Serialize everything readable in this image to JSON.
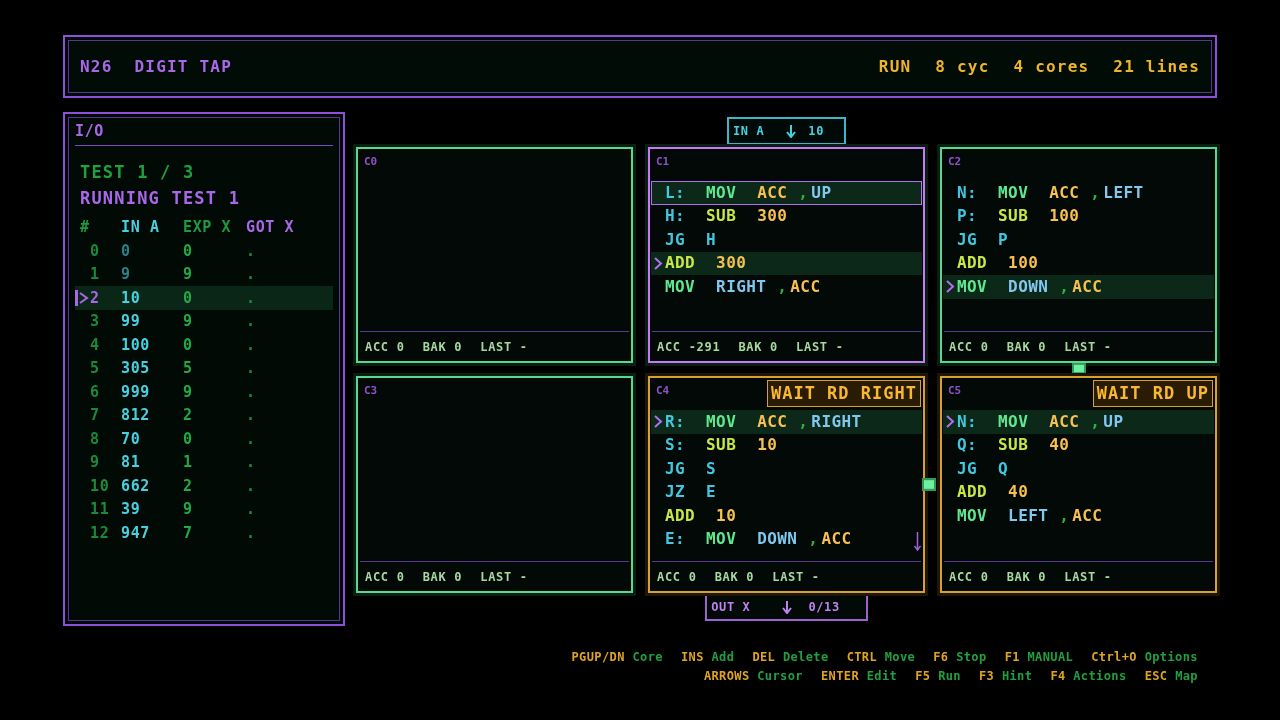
{
  "header": {
    "puzzle_number": "N26",
    "title": "DIGIT TAP",
    "stats": [
      "RUN",
      "8 cyc",
      "4 cores",
      "21 lines"
    ]
  },
  "io": {
    "title": "I/O",
    "test": "TEST 1 / 3",
    "status": "RUNNING TEST 1",
    "columns": [
      {
        "label": "#",
        "kind": "index"
      },
      {
        "label": "IN A",
        "kind": "input"
      },
      {
        "label": "EXP X",
        "kind": "expected"
      },
      {
        "label": "GOT X",
        "kind": "output"
      }
    ],
    "rows": [
      {
        "index": "0",
        "input": "0",
        "expected": "0",
        "got": ".",
        "consumed": true,
        "selected": false
      },
      {
        "index": "1",
        "input": "9",
        "expected": "9",
        "got": ".",
        "consumed": true,
        "selected": false
      },
      {
        "index": "2",
        "input": "10",
        "expected": "0",
        "got": ".",
        "consumed": false,
        "selected": true
      },
      {
        "index": "3",
        "input": "99",
        "expected": "9",
        "got": ".",
        "consumed": false,
        "selected": false
      },
      {
        "index": "4",
        "input": "100",
        "expected": "0",
        "got": ".",
        "consumed": false,
        "selected": false
      },
      {
        "index": "5",
        "input": "305",
        "expected": "5",
        "got": ".",
        "consumed": false,
        "selected": false
      },
      {
        "index": "6",
        "input": "999",
        "expected": "9",
        "got": ".",
        "consumed": false,
        "selected": false
      },
      {
        "index": "7",
        "input": "812",
        "expected": "2",
        "got": ".",
        "consumed": false,
        "selected": false
      },
      {
        "index": "8",
        "input": "70",
        "expected": "0",
        "got": ".",
        "consumed": false,
        "selected": false
      },
      {
        "index": "9",
        "input": "81",
        "expected": "1",
        "got": ".",
        "consumed": false,
        "selected": false
      },
      {
        "index": "10",
        "input": "662",
        "expected": "2",
        "got": ".",
        "consumed": false,
        "selected": false
      },
      {
        "index": "11",
        "input": "39",
        "expected": "9",
        "got": ".",
        "consumed": false,
        "selected": false
      },
      {
        "index": "12",
        "input": "947",
        "expected": "7",
        "got": ".",
        "consumed": false,
        "selected": false
      }
    ]
  },
  "cores": [
    {
      "name": "C0",
      "selected": false,
      "waiting": false,
      "registers": [
        "ACC 0",
        "BAK 0",
        "LAST -"
      ]
    },
    {
      "name": "C1",
      "selected": true,
      "waiting": false,
      "input_port": {
        "label": "IN A",
        "value": "10"
      },
      "lines": [
        {
          "active": false,
          "cursor": true,
          "tokens": [
            {
              "text": "L:",
              "kind": "label"
            },
            {
              "text": "MOV",
              "kind": "move"
            },
            {
              "text": "ACC",
              "kind": "register"
            },
            {
              "text": ",",
              "kind": "comma"
            },
            {
              "text": "UP",
              "kind": "port"
            }
          ]
        },
        {
          "active": false,
          "cursor": false,
          "tokens": [
            {
              "text": "H:",
              "kind": "label"
            },
            {
              "text": "SUB",
              "kind": "math"
            },
            {
              "text": "300",
              "kind": "number"
            }
          ]
        },
        {
          "active": false,
          "cursor": false,
          "tokens": [
            {
              "text": "JG",
              "kind": "jump"
            },
            {
              "text": "H",
              "kind": "target"
            }
          ]
        },
        {
          "active": true,
          "cursor": false,
          "tokens": [
            {
              "text": "ADD",
              "kind": "math"
            },
            {
              "text": "300",
              "kind": "number"
            }
          ]
        },
        {
          "active": false,
          "cursor": false,
          "tokens": [
            {
              "text": "MOV",
              "kind": "move"
            },
            {
              "text": "RIGHT",
              "kind": "port"
            },
            {
              "text": ",",
              "kind": "comma"
            },
            {
              "text": "ACC",
              "kind": "register"
            }
          ]
        }
      ],
      "registers": [
        "ACC -291",
        "BAK 0",
        "LAST -"
      ]
    },
    {
      "name": "C2",
      "selected": false,
      "waiting": false,
      "signal": {
        "kind": "down"
      },
      "lines": [
        {
          "active": false,
          "cursor": false,
          "tokens": [
            {
              "text": "N:",
              "kind": "label"
            },
            {
              "text": "MOV",
              "kind": "move"
            },
            {
              "text": "ACC",
              "kind": "register"
            },
            {
              "text": ",",
              "kind": "comma"
            },
            {
              "text": "LEFT",
              "kind": "port"
            }
          ]
        },
        {
          "active": false,
          "cursor": false,
          "tokens": [
            {
              "text": "P:",
              "kind": "label"
            },
            {
              "text": "SUB",
              "kind": "math"
            },
            {
              "text": "100",
              "kind": "number"
            }
          ]
        },
        {
          "active": false,
          "cursor": false,
          "tokens": [
            {
              "text": "JG",
              "kind": "jump"
            },
            {
              "text": "P",
              "kind": "target"
            }
          ]
        },
        {
          "active": false,
          "cursor": false,
          "tokens": [
            {
              "text": "ADD",
              "kind": "math"
            },
            {
              "text": "100",
              "kind": "number"
            }
          ]
        },
        {
          "active": true,
          "cursor": false,
          "tokens": [
            {
              "text": "MOV",
              "kind": "move"
            },
            {
              "text": "DOWN",
              "kind": "port"
            },
            {
              "text": ",",
              "kind": "comma"
            },
            {
              "text": "ACC",
              "kind": "register"
            }
          ]
        }
      ],
      "registers": [
        "ACC 0",
        "BAK 0",
        "LAST -"
      ]
    },
    {
      "name": "C3",
      "selected": false,
      "waiting": false,
      "registers": [
        "ACC 0",
        "BAK 0",
        "LAST -"
      ]
    },
    {
      "name": "C4",
      "selected": false,
      "waiting": true,
      "badge": "WAIT RD RIGHT",
      "more_below": true,
      "signal": {
        "kind": "right"
      },
      "output_port": {
        "label": "OUT X",
        "value": "0/13"
      },
      "lines": [
        {
          "active": true,
          "cursor": false,
          "tokens": [
            {
              "text": "R:",
              "kind": "label"
            },
            {
              "text": "MOV",
              "kind": "move"
            },
            {
              "text": "ACC",
              "kind": "register"
            },
            {
              "text": ",",
              "kind": "comma"
            },
            {
              "text": "RIGHT",
              "kind": "port"
            }
          ]
        },
        {
          "active": false,
          "cursor": false,
          "tokens": [
            {
              "text": "S:",
              "kind": "label"
            },
            {
              "text": "SUB",
              "kind": "math"
            },
            {
              "text": "10",
              "kind": "number"
            }
          ]
        },
        {
          "active": false,
          "cursor": false,
          "tokens": [
            {
              "text": "JG",
              "kind": "jump"
            },
            {
              "text": "S",
              "kind": "target"
            }
          ]
        },
        {
          "active": false,
          "cursor": false,
          "tokens": [
            {
              "text": "JZ",
              "kind": "jump"
            },
            {
              "text": "E",
              "kind": "target"
            }
          ]
        },
        {
          "active": false,
          "cursor": false,
          "tokens": [
            {
              "text": "ADD",
              "kind": "math"
            },
            {
              "text": "10",
              "kind": "number"
            }
          ]
        },
        {
          "active": false,
          "cursor": false,
          "tokens": [
            {
              "text": "E:",
              "kind": "label"
            },
            {
              "text": "MOV",
              "kind": "move"
            },
            {
              "text": "DOWN",
              "kind": "port"
            },
            {
              "text": ",",
              "kind": "comma"
            },
            {
              "text": "ACC",
              "kind": "register"
            }
          ]
        }
      ],
      "registers": [
        "ACC 0",
        "BAK 0",
        "LAST -"
      ]
    },
    {
      "name": "C5",
      "selected": false,
      "waiting": true,
      "badge": "WAIT RD UP",
      "lines": [
        {
          "active": true,
          "cursor": false,
          "tokens": [
            {
              "text": "N:",
              "kind": "label"
            },
            {
              "text": "MOV",
              "kind": "move"
            },
            {
              "text": "ACC",
              "kind": "register"
            },
            {
              "text": ",",
              "kind": "comma"
            },
            {
              "text": "UP",
              "kind": "port"
            }
          ]
        },
        {
          "active": false,
          "cursor": false,
          "tokens": [
            {
              "text": "Q:",
              "kind": "label"
            },
            {
              "text": "SUB",
              "kind": "math"
            },
            {
              "text": "40",
              "kind": "number"
            }
          ]
        },
        {
          "active": false,
          "cursor": false,
          "tokens": [
            {
              "text": "JG",
              "kind": "jump"
            },
            {
              "text": "Q",
              "kind": "target"
            }
          ]
        },
        {
          "active": false,
          "cursor": false,
          "tokens": [
            {
              "text": "ADD",
              "kind": "math"
            },
            {
              "text": "40",
              "kind": "number"
            }
          ]
        },
        {
          "active": false,
          "cursor": false,
          "tokens": [
            {
              "text": "MOV",
              "kind": "move"
            },
            {
              "text": "LEFT",
              "kind": "port"
            },
            {
              "text": ",",
              "kind": "comma"
            },
            {
              "text": "ACC",
              "kind": "register"
            }
          ]
        }
      ],
      "registers": [
        "ACC 0",
        "BAK 0",
        "LAST -"
      ]
    }
  ],
  "hotkeys": [
    [
      {
        "key": "PGUP/DN",
        "action": "Core"
      },
      {
        "key": "INS",
        "action": "Add"
      },
      {
        "key": "DEL",
        "action": "Delete"
      },
      {
        "key": "CTRL",
        "action": "Move"
      },
      {
        "key": "F6",
        "action": "Stop"
      },
      {
        "key": "F1",
        "action": "MANUAL"
      },
      {
        "key": "Ctrl+O",
        "action": "Options"
      }
    ],
    [
      {
        "key": "ARROWS",
        "action": "Cursor"
      },
      {
        "key": "ENTER",
        "action": "Edit"
      },
      {
        "key": "F5",
        "action": "Run"
      },
      {
        "key": "F3",
        "action": "Hint"
      },
      {
        "key": "F4",
        "action": "Actions"
      },
      {
        "key": "ESC",
        "action": "Map"
      }
    ]
  ]
}
